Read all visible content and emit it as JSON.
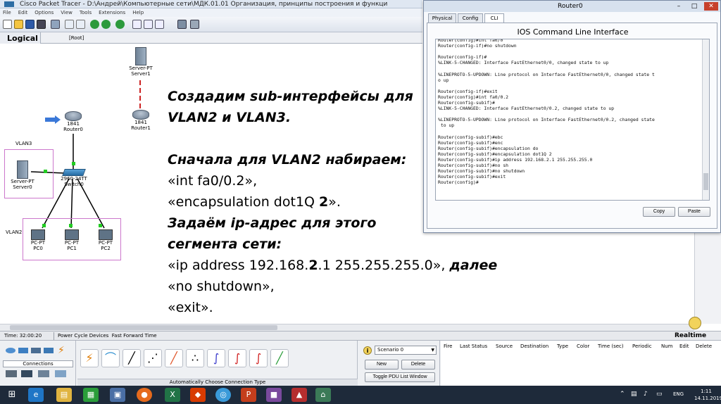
{
  "app": {
    "title": "Cisco Packet Tracer - D:\\Андрей\\Компьютерные сети\\МДК.01.01 Организация, принципы построения и функци",
    "menu": [
      "File",
      "Edit",
      "Options",
      "View",
      "Tools",
      "Extensions",
      "Help"
    ],
    "logical_tab": "Logical",
    "root_label": "[Root]"
  },
  "topology": {
    "server1": {
      "type": "Server-PT",
      "name": "Server1"
    },
    "router1": {
      "model": "1841",
      "name": "Router1"
    },
    "router0": {
      "model": "1841",
      "name": "Router0"
    },
    "switch0": {
      "model": "2960-24TT",
      "name": "Switch0"
    },
    "server0": {
      "type": "Server-PT",
      "name": "Server0"
    },
    "pc0": {
      "type": "PC-PT",
      "name": "PC0"
    },
    "pc1": {
      "type": "PC-PT",
      "name": "PC1"
    },
    "pc2": {
      "type": "PC-PT",
      "name": "PC2"
    },
    "vlan3_label": "VLAN3",
    "vlan2_label": "VLAN2"
  },
  "slide": {
    "line1": "Создадим sub-интерфейсы для",
    "line2": "VLAN2 и VLAN3.",
    "line3": "Сначала для VLAN2 набираем:",
    "line4": "«int fa0/0.2»,",
    "line5_pre": "«encapsulation dot1Q ",
    "line5_bold": "2",
    "line5_post": "».",
    "line6": "Задаём ip-адрес для этого",
    "line7": "сегмента сети:",
    "line8_pre": "«ip address 192.168.",
    "line8_bold": "2",
    "line8_post": ".1 255.255.255.0», ",
    "line8_italic": "далее",
    "line9": "«no shutdown»,",
    "line10": "«exit»."
  },
  "router_window": {
    "title": "Router0",
    "tabs": [
      "Physical",
      "Config",
      "CLI"
    ],
    "active_tab": "CLI",
    "panel_title": "IOS Command Line Interface",
    "cli_lines": [
      "Router(config)#int fa0/0",
      "Router(config-if)#no shutdown",
      "",
      "Router(config-if)#",
      "%LINK-5-CHANGED: Interface FastEthernet0/0, changed state to up",
      "",
      "%LINEPROTO-5-UPDOWN: Line protocol on Interface FastEthernet0/0, changed state t",
      "o up",
      "",
      "Router(config-if)#exit",
      "Router(config)#int fa0/0.2",
      "Router(config-subif)#",
      "%LINK-5-CHANGED: Interface FastEthernet0/0.2, changed state to up",
      "",
      "%LINEPROTO-5-UPDOWN: Line protocol on Interface FastEthernet0/0.2, changed state",
      " to up",
      "",
      "Router(config-subif)#ebc",
      "Router(config-subif)#enc",
      "Router(config-subif)#encapsulation do",
      "Router(config-subif)#encapsulation dot1Q 2",
      "Router(config-subif)#ip address 192.168.2.1 255.255.255.0",
      "Router(config-subif)#no sh",
      "Router(config-subif)#no shutdown",
      "Router(config-subif)#exit",
      "Router(config)#"
    ],
    "copy_label": "Copy",
    "paste_label": "Paste"
  },
  "status": {
    "time": "Time: 32:00:20",
    "power": "Power Cycle Devices",
    "fast_forward": "Fast Forward Time",
    "mode": "Realtime"
  },
  "bottom": {
    "connections_label": "Connections",
    "auto_connection": "Automatically Choose Connection Type",
    "scenario_value": "Scenario 0",
    "new_label": "New",
    "delete_label": "Delete",
    "toggle_label": "Toggle PDU List Window",
    "pdu_headers": [
      "Fire",
      "Last Status",
      "Source",
      "Destination",
      "Type",
      "Color",
      "Time (sec)",
      "Periodic",
      "Num",
      "Edit",
      "Delete"
    ]
  },
  "taskbar": {
    "lang": "ENG",
    "time": "1:11",
    "date": "14.11.2019"
  },
  "colors": {
    "accent": "#1e2a3a",
    "vlan_box": "#cc77cc",
    "link_up": "#22cc22",
    "link_fault": "#cc2222",
    "close_button": "#c7412c"
  }
}
